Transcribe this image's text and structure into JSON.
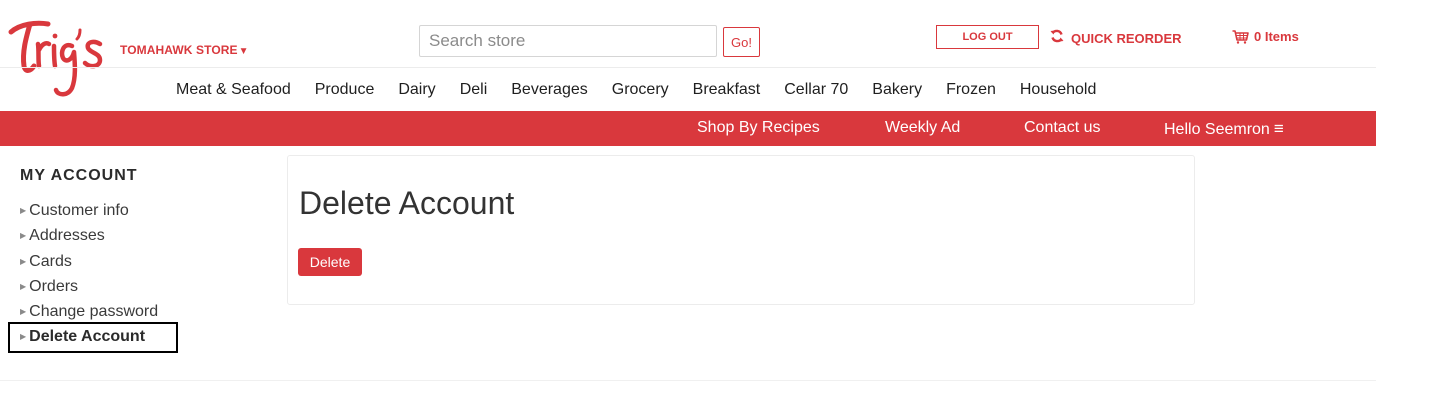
{
  "brand": {
    "logo_text": "Trig's",
    "store_name": "TOMAHAWK STORE",
    "accent_color": "#d9383d"
  },
  "search": {
    "placeholder": "Search store",
    "value": "",
    "button_label": "Go!"
  },
  "account_actions": {
    "logout_label": "LOG OUT",
    "quick_reorder_label": "QUICK REORDER",
    "quick_reorder_icon": "refresh-icon",
    "cart_icon": "cart-icon",
    "cart_label": "0 Items"
  },
  "categories": [
    "Meat & Seafood",
    "Produce",
    "Dairy",
    "Deli",
    "Beverages",
    "Grocery",
    "Breakfast",
    "Cellar 70",
    "Bakery",
    "Frozen",
    "Household"
  ],
  "secondary_nav": {
    "recipes": "Shop By Recipes",
    "weekly_ad": "Weekly Ad",
    "contact": "Contact us",
    "greeting": "Hello Seemron",
    "menu_icon": "hamburger-menu-icon"
  },
  "sidebar": {
    "title": "MY ACCOUNT",
    "items": [
      {
        "label": "Customer info",
        "active": false
      },
      {
        "label": "Addresses",
        "active": false
      },
      {
        "label": "Cards",
        "active": false
      },
      {
        "label": "Orders",
        "active": false
      },
      {
        "label": "Change password",
        "active": false
      },
      {
        "label": "Delete Account",
        "active": true
      }
    ]
  },
  "main": {
    "title": "Delete Account",
    "delete_button_label": "Delete"
  }
}
